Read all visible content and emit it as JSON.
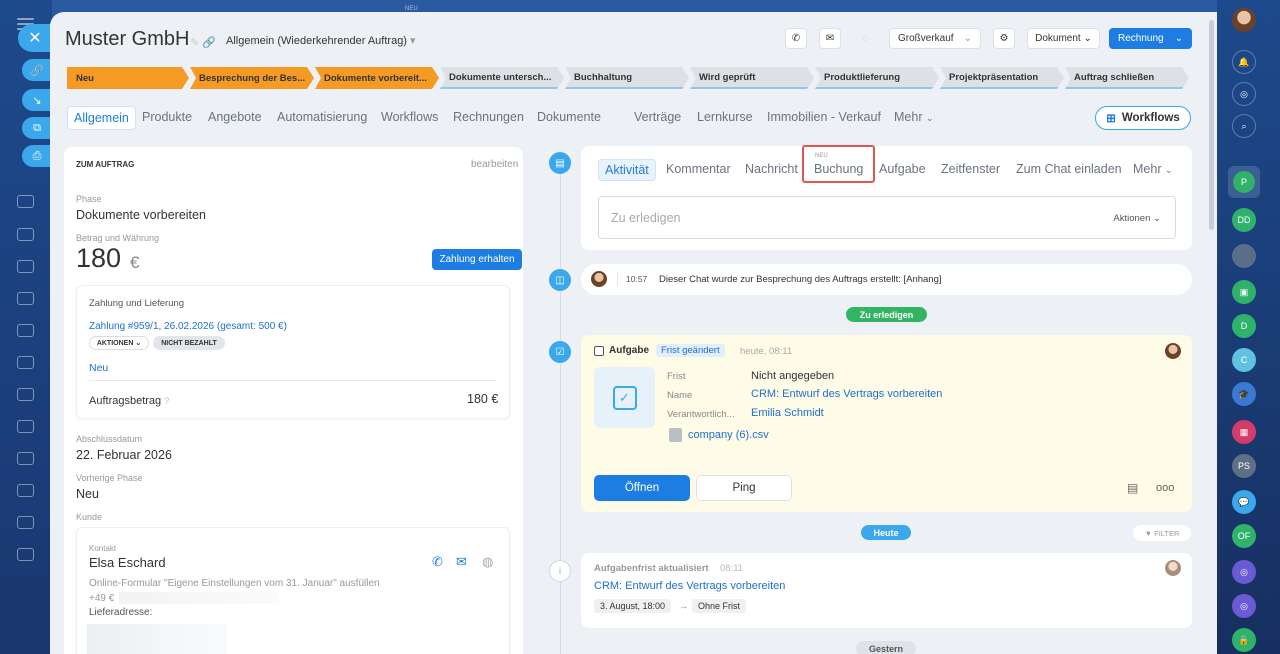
{
  "bg": {
    "top_label": "NEU"
  },
  "header": {
    "title": "Muster GmbH",
    "subtitle": "Allgemein (Wiederkehrender Auftrag)",
    "groups_label": "Großverkauf",
    "document_label": "Dokument",
    "invoice_label": "Rechnung"
  },
  "stages": [
    "Neu",
    "Besprechung der Bes...",
    "Dokumente vorbereit...",
    "Dokumente untersch...",
    "Buchhaltung",
    "Wird geprüft",
    "Produktlieferung",
    "Projektpräsentation",
    "Auftrag schließen"
  ],
  "tabs": [
    "Allgemein",
    "Produkte",
    "Angebote",
    "Automatisierung",
    "Workflows",
    "Rechnungen",
    "Dokumente",
    "Verträge",
    "Lernkurse",
    "Immobilien - Verkauf",
    "Mehr"
  ],
  "workflows_button": "Workflows",
  "left": {
    "section_title": "ZUM AUFTRAG",
    "edit_label": "bearbeiten",
    "phase_label": "Phase",
    "phase_value": "Dokumente vorbereiten",
    "amount_label": "Betrag und Währung",
    "amount": "180",
    "currency": "€",
    "pay_button": "Zahlung erhalten",
    "payment_section": "Zahlung und Lieferung",
    "payment_link": "Zahlung #959/1, 26.02.2026 (gesamt: 500 €)",
    "actions_pill": "AKTIONEN",
    "unpaid_pill": "NICHT BEZAHLT",
    "new_link": "Neu",
    "order_amount_label": "Auftragsbetrag",
    "order_amount_value": "180 €",
    "close_date_label": "Abschlussdatum",
    "close_date_value": "22. Februar 2026",
    "prev_phase_label": "Vorherige Phase",
    "prev_phase_value": "Neu",
    "customer_label": "Kunde",
    "contact_label": "Kontakt",
    "contact_name": "Elsa Eschard",
    "contact_source": "Online-Formular \"Eigene Einstellungen vom 31. Januar\" ausfüllen",
    "contact_phone": "+49 €",
    "delivery_label": "Lieferadresse:"
  },
  "activity": {
    "tabs": [
      "Aktivität",
      "Kommentar",
      "Nachricht",
      "Buchung",
      "Aufgabe",
      "Zeitfenster",
      "Zum Chat einladen",
      "Mehr"
    ],
    "new_tag": "NEU",
    "todo_placeholder": "Zu erledigen",
    "actions_label": "Aktionen"
  },
  "chat_item": {
    "time": "10:57",
    "text": "Dieser Chat wurde zur Besprechung des Auftrags erstellt: [Anhang]"
  },
  "todo_badge": "Zu erledigen",
  "task": {
    "title": "Aufgabe",
    "tag": "Frist geändert",
    "when": "heute, 08:11",
    "deadline_label": "Frist",
    "deadline_value": "Nicht angegeben",
    "name_label": "Name",
    "name_value": "CRM: Entwurf des Vertrags vorbereiten",
    "resp_label": "Verantwortlich...",
    "resp_value": "Emilia Schmidt",
    "file": "company (6).csv",
    "open_button": "Öffnen",
    "ping_button": "Ping"
  },
  "today_badge": "Heute",
  "filter_label": "FILTER",
  "update": {
    "title": "Aufgabenfrist aktualisiert",
    "time": "08:11",
    "link": "CRM: Entwurf des Vertrags vorbereiten",
    "from": "3. August, 18:00",
    "arrow": "→",
    "to": "Ohne Frist"
  },
  "yesterday_badge": "Gestern",
  "right_strip": {
    "p": "P",
    "dd": "DD",
    "d": "D",
    "c": "C",
    "ps": "PS",
    "of": "OF"
  }
}
